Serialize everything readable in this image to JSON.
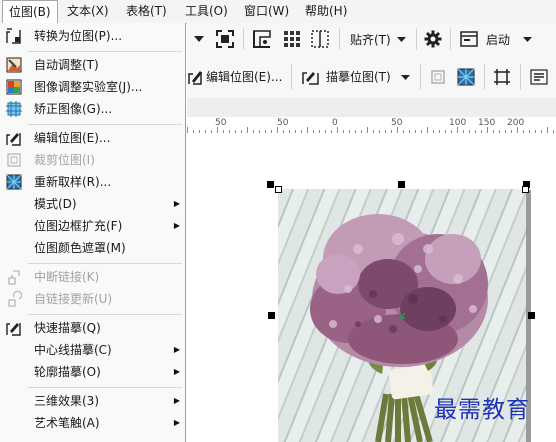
{
  "menubar": {
    "items": [
      {
        "label": "位图(B)",
        "open": true
      },
      {
        "label": "文本(X)"
      },
      {
        "label": "表格(T)"
      },
      {
        "label": "工具(O)"
      },
      {
        "label": "窗口(W)"
      },
      {
        "label": "帮助(H)"
      }
    ]
  },
  "toolbar1": {
    "snap_label": "贴齐(T)",
    "launch_label": "启动"
  },
  "toolbar2": {
    "edit_bitmap_label": "编辑位图(E)...",
    "trace_bitmap_label": "描摹位图(T)"
  },
  "ruler": {
    "labels": [
      "50",
      "50",
      "0",
      "50",
      "100",
      "150",
      "200"
    ]
  },
  "menu": {
    "items": [
      {
        "label": "转换为位图(P)...",
        "icon": "convert-to-bitmap-icon",
        "enabled": true
      },
      {
        "label": "自动调整(T)",
        "icon": "auto-adjust-icon",
        "enabled": true
      },
      {
        "label": "图像调整实验室(J)...",
        "icon": "image-adjustment-lab-icon",
        "enabled": true
      },
      {
        "label": "矫正图像(G)...",
        "icon": "straighten-image-icon",
        "enabled": true
      },
      {
        "label": "编辑位图(E)...",
        "icon": "edit-bitmap-icon",
        "enabled": true
      },
      {
        "label": "裁剪位图(I)",
        "icon": "crop-bitmap-icon",
        "enabled": false
      },
      {
        "label": "重新取样(R)...",
        "icon": "resample-icon",
        "enabled": true
      },
      {
        "label": "模式(D)",
        "enabled": true,
        "submenu": true
      },
      {
        "label": "位图边框扩充(F)",
        "enabled": true,
        "submenu": true
      },
      {
        "label": "位图颜色遮罩(M)",
        "enabled": true
      },
      {
        "label": "中断链接(K)",
        "icon": "break-link-icon",
        "enabled": false
      },
      {
        "label": "自链接更新(U)",
        "icon": "update-link-icon",
        "enabled": false
      },
      {
        "label": "快速描摹(Q)",
        "icon": "quick-trace-icon",
        "enabled": true
      },
      {
        "label": "中心线描摹(C)",
        "enabled": true,
        "submenu": true
      },
      {
        "label": "轮廓描摹(O)",
        "enabled": true,
        "submenu": true
      },
      {
        "label": "三维效果(3)",
        "enabled": true,
        "submenu": true
      },
      {
        "label": "艺术笔触(A)",
        "enabled": true,
        "submenu": true
      }
    ],
    "submenu_arrow": "▶"
  },
  "watermark": "最需教育",
  "colors": {
    "menu_bg": "#f9f9f9",
    "disabled_text": "#a3a3a3",
    "watermark": "#1e33b8",
    "lilac": "#a0608e"
  }
}
